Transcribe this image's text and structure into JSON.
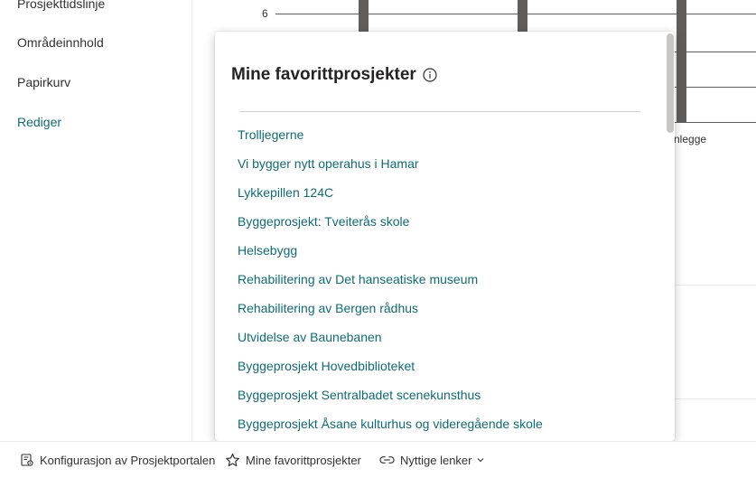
{
  "sidebar": {
    "items": [
      {
        "label": "Prosjekttidslinje"
      },
      {
        "label": "Områdeinnhold"
      },
      {
        "label": "Papirkurv"
      },
      {
        "label": "Rediger"
      }
    ]
  },
  "chart": {
    "y_tick": "6",
    "category_partial": "nlegge"
  },
  "favorites": {
    "title": "Mine favorittprosjekter",
    "items": [
      "Trolljegerne",
      "Vi bygger nytt operahus i Hamar",
      "Lykkepillen 124C",
      "Byggeprosjekt: Tveiterås skole",
      "Helsebygg",
      "Rehabilitering av Det hanseatiske museum",
      "Rehabilitering av Bergen rådhus",
      "Utvidelse av Baunebanen",
      "Byggeprosjekt Hovedbiblioteket",
      "Byggeprosjekt Sentralbadet scenekunsthus",
      "Byggeprosjekt Åsane kulturhus og videregående skole"
    ]
  },
  "footer": {
    "config_label": "Konfigurasjon av Prosjektportalen",
    "favorites_label": "Mine favorittprosjekter",
    "links_label": "Nyttige lenker"
  },
  "colors": {
    "accent": "#0f6c74",
    "bar": "#605e5c"
  }
}
